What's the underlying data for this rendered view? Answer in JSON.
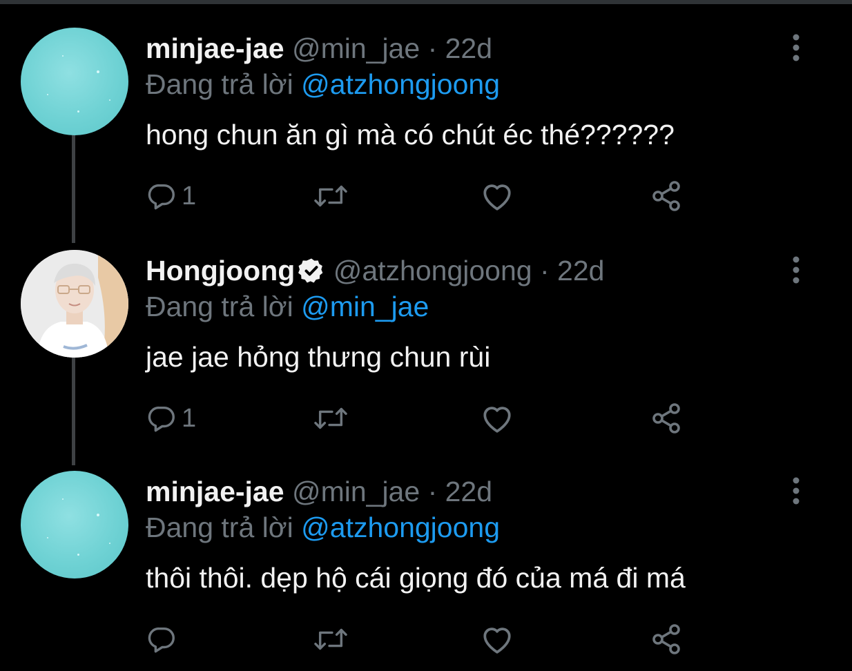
{
  "colors": {
    "background": "#000000",
    "text_primary": "#f2f2f2",
    "text_secondary": "#6e767d",
    "link_blue": "#1d9bf0",
    "thread_line": "#3e4144"
  },
  "reply_prefix": "Đang trả lời",
  "tweets": [
    {
      "display_name": "minjae-jae",
      "handle": "@min_jae",
      "separator": "·",
      "time": "22d",
      "verified": false,
      "reply_to": "@atzhongjoong",
      "text": "hong chun ăn gì mà có chút éc thé??????",
      "reply_count": "1",
      "avatar": "teal-sparkle-avatar"
    },
    {
      "display_name": "Hongjoong",
      "handle": "@atzhongjoong",
      "separator": "·",
      "time": "22d",
      "verified": true,
      "reply_to": "@min_jae",
      "text": "jae jae hỏng thưng chun rùi",
      "reply_count": "1",
      "avatar": "profile-photo-avatar"
    },
    {
      "display_name": "minjae-jae",
      "handle": "@min_jae",
      "separator": "·",
      "time": "22d",
      "verified": false,
      "reply_to": "@atzhongjoong",
      "text": "thôi thôi. dẹp hộ cái giọng đó của má đi má",
      "reply_count": "",
      "avatar": "teal-sparkle-avatar"
    }
  ]
}
